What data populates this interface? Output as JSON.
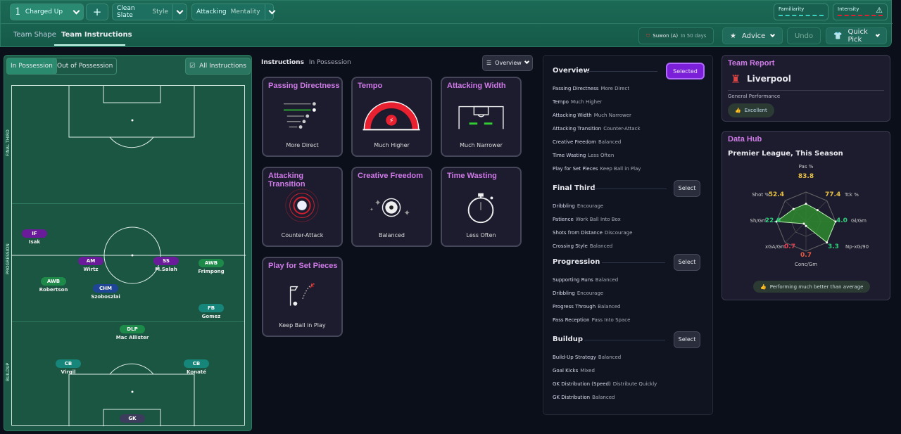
{
  "topbar": {
    "tactic_number": "1",
    "tactic_name": "Charged Up",
    "add": "+",
    "style_value": "Clean Slate",
    "style_label": "Style",
    "mentality_value": "Attacking",
    "mentality_label": "Mentality",
    "familiarity": "Familiarity",
    "intensity": "Intensity"
  },
  "tabs": [
    {
      "label": "Team Shape",
      "active": false
    },
    {
      "label": "Team Instructions",
      "active": true
    }
  ],
  "next_match": {
    "opponent": "Suwon (A)",
    "when": "In 50 days"
  },
  "actions": {
    "advice": "Advice",
    "undo": "Undo",
    "quick_pick": "Quick Pick"
  },
  "pitch_panel": {
    "in_possession": "In Possession",
    "out_possession": "Out of Possession",
    "all_instructions": "All Instructions",
    "zones": [
      "FINAL THIRD",
      "PROGRESSION",
      "BUILDUP"
    ],
    "players": [
      {
        "role": "IF",
        "name": "Isak",
        "color": "#6a1b9a"
      },
      {
        "role": "AM",
        "name": "Wirtz",
        "color": "#6a1b9a"
      },
      {
        "role": "SS",
        "name": "M.Salah",
        "color": "#6a1b9a"
      },
      {
        "role": "AWB",
        "name": "Frimpong",
        "color": "#1e8a4a"
      },
      {
        "role": "AWB",
        "name": "Robertson",
        "color": "#1e8a4a"
      },
      {
        "role": "CHM",
        "name": "Szoboszlai",
        "color": "#1f4596"
      },
      {
        "role": "FB",
        "name": "Gomez",
        "color": "#16857a"
      },
      {
        "role": "DLP",
        "name": "Mac Allister",
        "color": "#1e8a4a"
      },
      {
        "role": "CB",
        "name": "Virgil",
        "color": "#16857a"
      },
      {
        "role": "CB",
        "name": "Konaté",
        "color": "#16857a"
      },
      {
        "role": "GK",
        "name": "",
        "color": "#3c3c5c"
      }
    ]
  },
  "instructions": {
    "title": "Instructions",
    "subtitle": "In Possession",
    "view": "Overview",
    "cards": [
      {
        "title": "Passing Directness",
        "value": "More Direct",
        "icon": "passing-arrows-icon"
      },
      {
        "title": "Tempo",
        "value": "Much Higher",
        "icon": "tempo-gauge-icon"
      },
      {
        "title": "Attacking Width",
        "value": "Much Narrower",
        "icon": "width-goal-icon"
      },
      {
        "title": "Attacking Transition",
        "value": "Counter-Attack",
        "icon": "transition-rings-icon"
      },
      {
        "title": "Creative Freedom",
        "value": "Balanced",
        "icon": "ball-sparkle-icon"
      },
      {
        "title": "Time Wasting",
        "value": "Less Often",
        "icon": "stopwatch-icon"
      },
      {
        "title": "Play for Set Pieces",
        "value": "Keep Ball in Play",
        "icon": "set-piece-flag-icon"
      }
    ]
  },
  "overview": {
    "sections": [
      {
        "title": "Overview",
        "button": "Selected",
        "selected": true,
        "items": [
          [
            "Passing Directness",
            "More Direct"
          ],
          [
            "Tempo",
            "Much Higher"
          ],
          [
            "Attacking Width",
            "Much Narrower"
          ],
          [
            "Attacking Transition",
            "Counter-Attack"
          ],
          [
            "Creative Freedom",
            "Balanced"
          ],
          [
            "Time Wasting",
            "Less Often"
          ],
          [
            "Play for Set Pieces",
            "Keep Ball in Play"
          ]
        ]
      },
      {
        "title": "Final Third",
        "button": "Select",
        "selected": false,
        "items": [
          [
            "Dribbling",
            "Encourage"
          ],
          [
            "Patience",
            "Work Ball Into Box"
          ],
          [
            "Shots from Distance",
            "Discourage"
          ],
          [
            "Crossing Style",
            "Balanced"
          ]
        ]
      },
      {
        "title": "Progression",
        "button": "Select",
        "selected": false,
        "items": [
          [
            "Supporting Runs",
            "Balanced"
          ],
          [
            "Dribbling",
            "Encourage"
          ],
          [
            "Progress Through",
            "Balanced"
          ],
          [
            "Pass Reception",
            "Pass Into Space"
          ]
        ]
      },
      {
        "title": "Buildup",
        "button": "Select",
        "selected": false,
        "items": [
          [
            "Build-Up Strategy",
            "Balanced"
          ],
          [
            "Goal Kicks",
            "Mixed"
          ],
          [
            "GK Distribution (Speed)",
            "Distribute Quickly"
          ],
          [
            "GK Distribution",
            "Balanced"
          ]
        ]
      }
    ]
  },
  "team_report": {
    "title": "Team Report",
    "team": "Liverpool",
    "perf_label": "General Performance",
    "perf_value": "Excellent"
  },
  "data_hub": {
    "title": "Data Hub",
    "subtitle": "Premier League, This Season",
    "verdict": "Performing much better than average",
    "chart_data": {
      "type": "radar",
      "axes": [
        {
          "label": "Pas %",
          "value": "83.8",
          "level": 0.6,
          "color": "#e8c040"
        },
        {
          "label": "Tck %",
          "value": "77.4",
          "level": 0.55,
          "color": "#e8c040"
        },
        {
          "label": "Gl/Gm",
          "value": "4.0",
          "level": 1.0,
          "color": "#2ecf7a"
        },
        {
          "label": "Np-xG/90",
          "value": "3.3",
          "level": 1.0,
          "color": "#2ecf7a"
        },
        {
          "label": "Conc/Gm",
          "value": "0.7",
          "level": 0.15,
          "color": "#e85a40"
        },
        {
          "label": "xGA/Gm",
          "value": "0.7",
          "level": 0.1,
          "color": "#e84050"
        },
        {
          "label": "Sh/Gm",
          "value": "22.6",
          "level": 1.0,
          "color": "#2ecf7a"
        },
        {
          "label": "Shot %",
          "value": "52.4",
          "level": 0.6,
          "color": "#e8c040"
        }
      ]
    }
  }
}
